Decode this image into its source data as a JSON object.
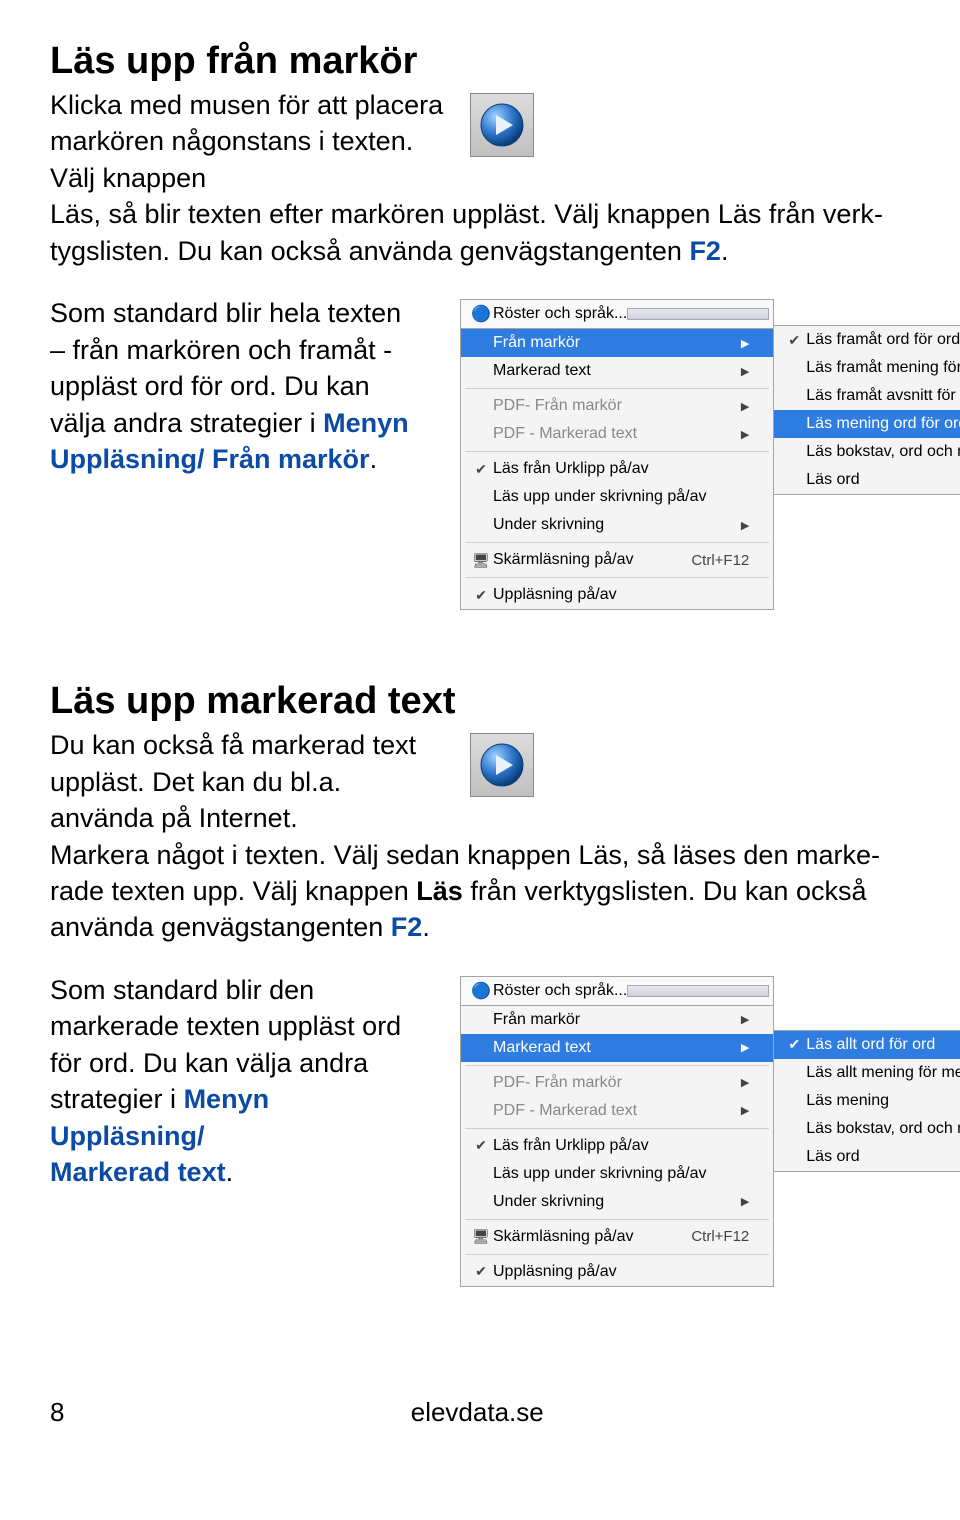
{
  "section1": {
    "heading": "Läs upp från markör",
    "intro1": "Klicka med musen för att placera markören någon­stans i texten. Välj knappen",
    "intro2_a": "Läs, så blir texten efter markören uppläst. Välj knappen Läs från verk­tygslisten. Du kan också använda genvägstangenten ",
    "intro2_f2": "F2",
    "intro2_end": ".",
    "p2_a": "Som standard blir hela texten – från markören och framåt - uppläst ord för ord. Du kan välja andra strategier i ",
    "p2_menu": "Menyn Uppläsning/ Från markör",
    "p2_end": "."
  },
  "section2": {
    "heading": "Läs upp markerad text",
    "intro1": "Du kan också få markerad text uppläst. Det kan du bl.a. använda på Internet.",
    "p2_a": "Markera något i texten. Välj sedan knappen Läs, så läses den marke­rade texten upp. Välj knappen ",
    "p2_bold": "Läs",
    "p2_b": " från verktygslisten. Du kan också använda genvägstangenten ",
    "p2_f2": "F2",
    "p2_end": ".",
    "p3_a": "Som standard blir den markerade texten uppläst ord för ord. Du kan välja andra strategier i ",
    "p3_menu1": "Menyn Uppläsning/",
    "p3_menu2": "Markerad text",
    "p3_end": "."
  },
  "menu1": {
    "top": "Röster och språk...",
    "items": [
      {
        "lbl": "Från markör",
        "hover": true,
        "arrow": true
      },
      {
        "lbl": "Markerad text",
        "arrow": true
      },
      {
        "lbl": "PDF- Från markör",
        "grey": true,
        "arrow": true
      },
      {
        "lbl": "PDF - Markerad text",
        "grey": true,
        "arrow": true
      },
      {
        "lbl": "Läs från Urklipp på/av",
        "check": true
      },
      {
        "lbl": "Läs upp under skrivning på/av"
      },
      {
        "lbl": "Under skrivning",
        "arrow": true
      },
      {
        "lbl": "Skärmläsning på/av",
        "shc": "Ctrl+F12",
        "icon": "screen"
      },
      {
        "lbl": "Uppläsning på/av",
        "check": true
      }
    ],
    "sub": [
      {
        "lbl": "Läs framåt ord för ord",
        "check": true
      },
      {
        "lbl": "Läs framåt mening för mening"
      },
      {
        "lbl": "Läs framåt avsnitt för avsnitt"
      },
      {
        "lbl": "Läs mening ord för ord",
        "hover": true
      },
      {
        "lbl": "Läs bokstav, ord och mening"
      },
      {
        "lbl": "Läs ord"
      }
    ]
  },
  "menu2": {
    "top": "Röster och språk...",
    "items": [
      {
        "lbl": "Från markör",
        "arrow": true
      },
      {
        "lbl": "Markerad text",
        "hover": true,
        "arrow": true
      },
      {
        "lbl": "PDF- Från markör",
        "grey": true,
        "arrow": true
      },
      {
        "lbl": "PDF - Markerad text",
        "grey": true,
        "arrow": true
      },
      {
        "lbl": "Läs från Urklipp på/av",
        "check": true
      },
      {
        "lbl": "Läs upp under skrivning på/av"
      },
      {
        "lbl": "Under skrivning",
        "arrow": true
      },
      {
        "lbl": "Skärmläsning på/av",
        "shc": "Ctrl+F12",
        "icon": "screen"
      },
      {
        "lbl": "Uppläsning på/av",
        "check": true
      }
    ],
    "sub": [
      {
        "lbl": "Läs allt ord för ord",
        "hover": true,
        "check": true
      },
      {
        "lbl": "Läs allt mening för mening"
      },
      {
        "lbl": "Läs mening"
      },
      {
        "lbl": "Läs bokstav, ord och mening"
      },
      {
        "lbl": "Läs ord"
      }
    ]
  },
  "footer": {
    "page": "8",
    "site": "elevdata.se"
  }
}
